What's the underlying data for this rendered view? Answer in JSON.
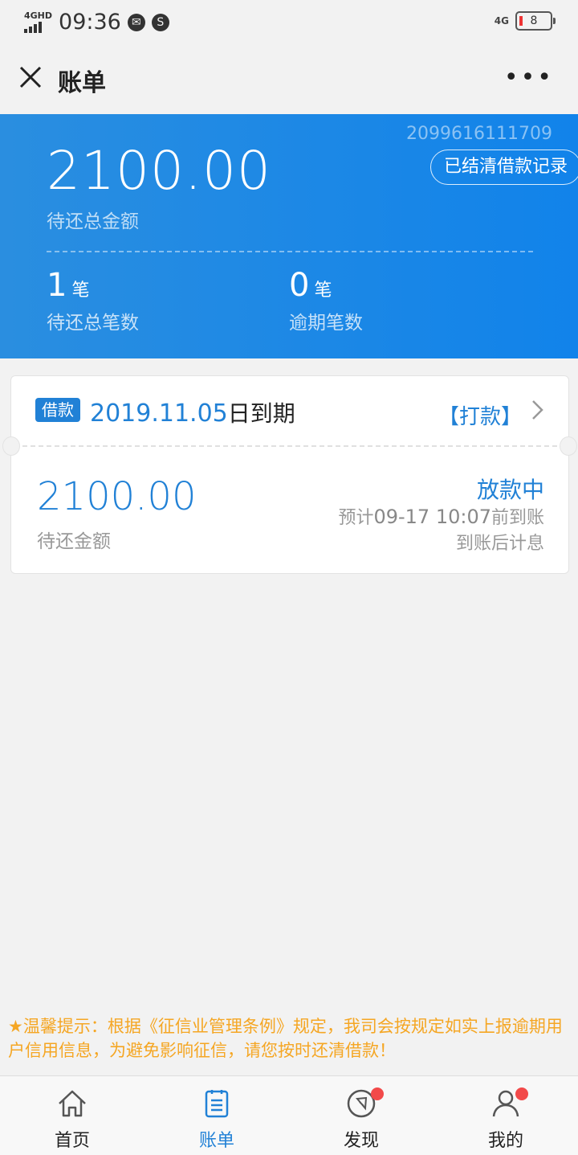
{
  "status_bar": {
    "network": "4GHD",
    "time": "09:36",
    "right_network": "4G",
    "battery": "8"
  },
  "nav": {
    "title": "账单",
    "more": "•••"
  },
  "summary": {
    "account_id": "2099616111709",
    "history_button": "已结清借款记录",
    "total_amount": "2100.00",
    "total_amount_label": "待还总金额",
    "pending_count": "1",
    "pending_unit": "笔",
    "pending_label": "待还总笔数",
    "overdue_count": "0",
    "overdue_unit": "笔",
    "overdue_label": "逾期笔数"
  },
  "loan_card": {
    "tag": "借款",
    "due_date": "2019.11.05",
    "due_suffix": "日到期",
    "action": "【打款】",
    "amount": "2100.00",
    "amount_label": "待还金额",
    "status": "放款中",
    "eta_prefix": "预计",
    "eta_time": "09-17 10:07",
    "eta_suffix": "前到账",
    "interest_note": "到账后计息"
  },
  "notice": "★温馨提示：根据《征信业管理条例》规定，我司会按规定如实上报逾期用户信用信息，为避免影响征信，请您按时还清借款！",
  "tabs": [
    {
      "label": "首页",
      "icon": "home-icon"
    },
    {
      "label": "账单",
      "icon": "bill-icon"
    },
    {
      "label": "发现",
      "icon": "compass-icon"
    },
    {
      "label": "我的",
      "icon": "user-icon"
    }
  ],
  "colors": {
    "primary": "#2181d6",
    "hero_bg": "#1d8ce6",
    "notice": "#f5a623",
    "badge": "#f24a4a"
  }
}
